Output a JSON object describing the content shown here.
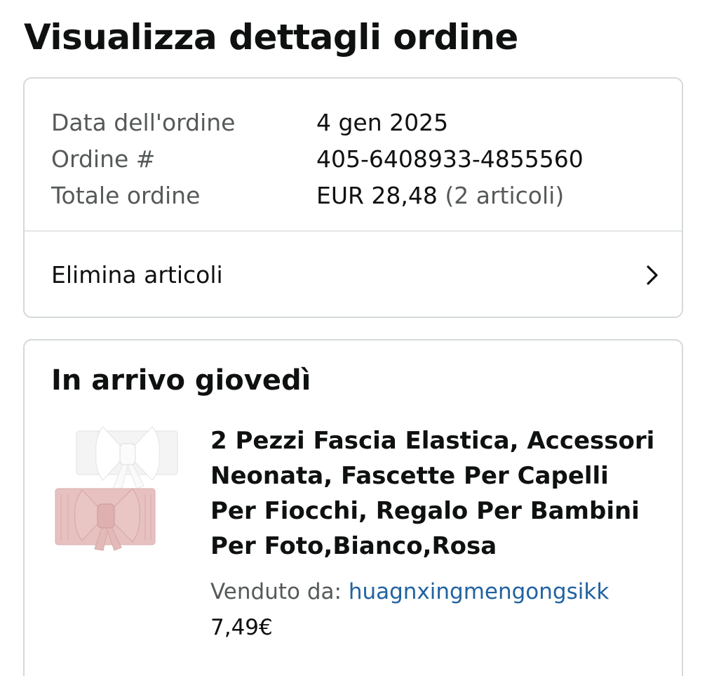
{
  "page": {
    "title": "Visualizza dettagli ordine"
  },
  "summary": {
    "rows": [
      {
        "label": "Data dell'ordine",
        "value": "4 gen 2025",
        "extra": ""
      },
      {
        "label": "Ordine #",
        "value": "405-6408933-4855560",
        "extra": ""
      },
      {
        "label": "Totale ordine",
        "value": "EUR 28,48",
        "extra": "(2 articoli)"
      }
    ],
    "remove_items_label": "Elimina articoli",
    "remove_items_icon": "chevron-right-icon"
  },
  "shipment": {
    "heading": "In arrivo giovedì",
    "item": {
      "image": "baby-bow-headbands-white-pink",
      "title": "2 Pezzi Fascia Elastica, Accessori Neonata, Fascette Per Capelli Per Fiocchi, Regalo Per Bambini Per Foto,Bianco,Rosa",
      "seller_label": "Venduto da:",
      "seller_name": "huagnxingmengongsikk",
      "price": "7,49€"
    }
  },
  "colors": {
    "text": "#0f1111",
    "muted": "#565959",
    "link": "#2162a1",
    "border": "#d5d9d9"
  }
}
